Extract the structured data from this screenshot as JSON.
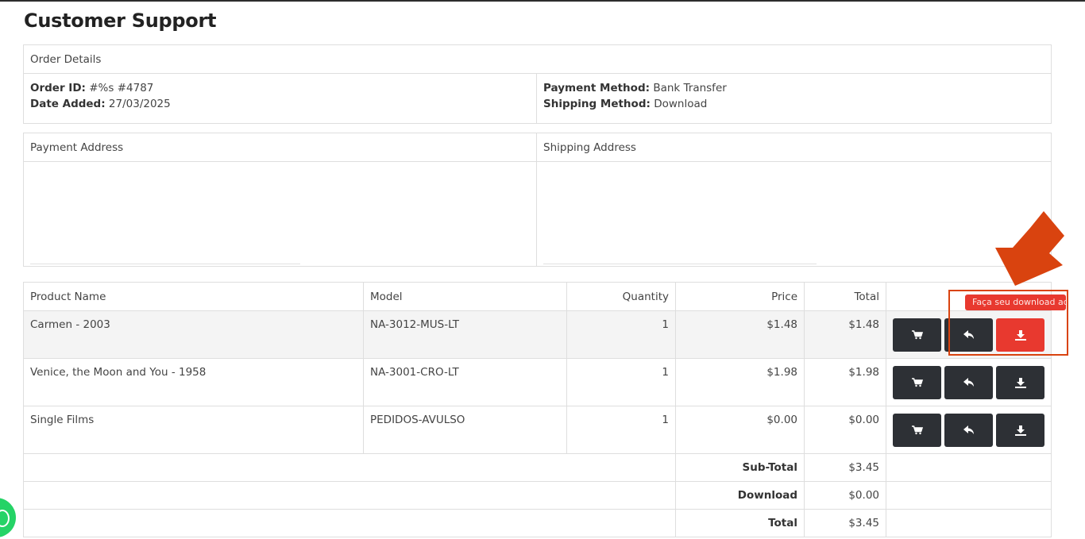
{
  "page": {
    "title": "Customer Support"
  },
  "order_details": {
    "header": "Order Details",
    "order_id_label": "Order ID:",
    "order_id_value": "#%s #4787",
    "date_added_label": "Date Added:",
    "date_added_value": "27/03/2025",
    "payment_method_label": "Payment Method:",
    "payment_method_value": "Bank Transfer",
    "shipping_method_label": "Shipping Method:",
    "shipping_method_value": "Download"
  },
  "addresses": {
    "payment_header": "Payment Address",
    "shipping_header": "Shipping Address"
  },
  "products": {
    "columns": [
      "Product Name",
      "Model",
      "Quantity",
      "Price",
      "Total"
    ],
    "rows": [
      {
        "name": "Carmen - 2003",
        "model": "NA-3012-MUS-LT",
        "quantity": "1",
        "price": "$1.48",
        "total": "$1.48"
      },
      {
        "name": "Venice, the Moon and You - 1958",
        "model": "NA-3001-CRO-LT",
        "quantity": "1",
        "price": "$1.98",
        "total": "$1.98"
      },
      {
        "name": "Single Films",
        "model": "PEDIDOS-AVULSO",
        "quantity": "1",
        "price": "$0.00",
        "total": "$0.00"
      }
    ],
    "totals": [
      {
        "label": "Sub-Total",
        "value": "$3.45"
      },
      {
        "label": "Download",
        "value": "$0.00"
      },
      {
        "label": "Total",
        "value": "$3.45"
      }
    ]
  },
  "actions": {
    "icons": [
      "cart-icon",
      "reply-icon",
      "download-icon"
    ],
    "tooltip": "Faça seu download aqui"
  },
  "colors": {
    "button_dark": "#2d3035",
    "button_active": "#e8392f",
    "annotation": "#d9430f",
    "whatsapp": "#25d366"
  }
}
